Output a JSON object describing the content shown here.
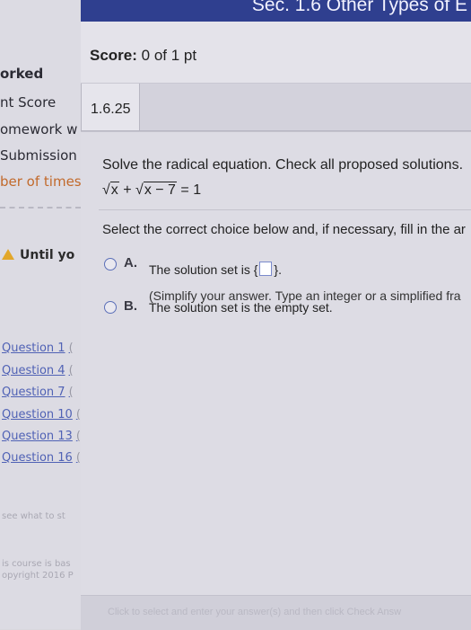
{
  "header": {
    "title": "Sec. 1.6 Other Types of E"
  },
  "sidebar": {
    "items": [
      {
        "label": "orked",
        "style": "bold"
      },
      {
        "label": "nt Score",
        "style": "normal"
      },
      {
        "label": "omework w",
        "style": "normal"
      },
      {
        "label": "Submission",
        "style": "normal"
      },
      {
        "label": "ber of times",
        "style": "link"
      }
    ],
    "until_label": "Until yo",
    "questions": [
      {
        "label": "Question 1",
        "mark": "("
      },
      {
        "label": "Question 4",
        "mark": "("
      },
      {
        "label": "Question 7",
        "mark": "("
      },
      {
        "label": "Question 10",
        "mark": "("
      },
      {
        "label": "Question 13",
        "mark": "("
      },
      {
        "label": "Question 16",
        "mark": "("
      }
    ],
    "see_what": "see what to st",
    "footer_line1": "is course is bas",
    "footer_line2": "opyright 2016 P"
  },
  "score": {
    "label": "Score:",
    "value": "0 of 1 pt"
  },
  "question": {
    "number": "1.6.25",
    "prompt": "Solve the radical equation. Check all proposed solutions.",
    "equation": {
      "term1": "x",
      "plus": "+",
      "term2": "x − 7",
      "equals": "= 1"
    },
    "instruction": "Select the correct choice below and, if necessary, fill in the ar",
    "choices": [
      {
        "letter": "A.",
        "text_before": "The solution set is {",
        "text_after": "}."
      },
      {
        "letter": "B.",
        "text": "The solution set is the empty set."
      }
    ],
    "hint": "(Simplify your answer. Type an integer or a simplified fra"
  },
  "footer": {
    "text": "Click to select and enter your answer(s) and then click Check Answ"
  }
}
